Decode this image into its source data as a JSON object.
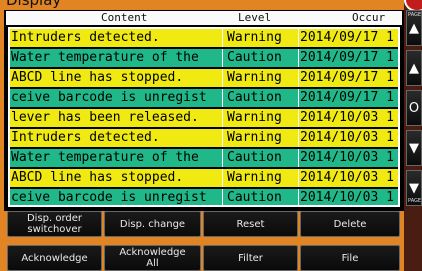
{
  "window": {
    "title": "Display"
  },
  "table": {
    "headers": {
      "content": "Content",
      "level": "Level",
      "occur": "Occur"
    },
    "rows": [
      {
        "content": "Intruders detected.",
        "level": "Warning",
        "occur": "2014/09/17 1",
        "type": "warn"
      },
      {
        "content": "Water temperature of the",
        "level": "Caution",
        "occur": "2014/09/17 1",
        "type": "caut"
      },
      {
        "content": "ABCD line has stopped.",
        "level": "Warning",
        "occur": "2014/09/17 1",
        "type": "warn"
      },
      {
        "content": "ceive barcode is unregist",
        "level": "Caution",
        "occur": "2014/09/17 1",
        "type": "caut"
      },
      {
        "content": " lever has been released.",
        "level": "Warning",
        "occur": "2014/10/03 1",
        "type": "warn"
      },
      {
        "content": "Intruders detected.",
        "level": "Warning",
        "occur": "2014/10/03 1",
        "type": "warn"
      },
      {
        "content": "Water temperature of the",
        "level": "Caution",
        "occur": "2014/10/03 1",
        "type": "caut"
      },
      {
        "content": "ABCD line has stopped.",
        "level": "Warning",
        "occur": "2014/10/03 1",
        "type": "warn"
      },
      {
        "content": "ceive barcode is unregist",
        "level": "Caution",
        "occur": "2014/10/03 1",
        "type": "caut"
      }
    ]
  },
  "buttons": {
    "disp_order": "Disp. order\nswitchover",
    "disp_change": "Disp. change",
    "reset": "Reset",
    "delete": "Delete",
    "acknowledge": "Acknowledge",
    "acknowledge_all": "Acknowledge\nAll",
    "filter": "Filter",
    "file": "File"
  },
  "side": {
    "page_up_label": "PAGE",
    "up_arrow": "▲",
    "o_label": "O",
    "down_arrow": "▼",
    "page_down_label": "PAGE"
  },
  "colors": {
    "warning": "#f1ea12",
    "caution": "#20b888",
    "frame": "#e08424"
  }
}
